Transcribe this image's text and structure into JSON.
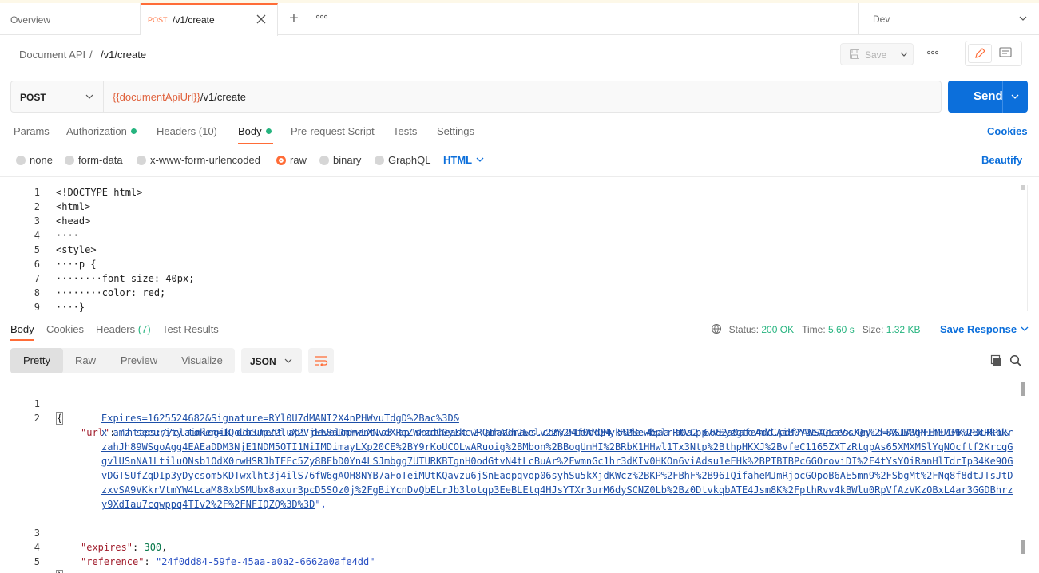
{
  "tabs": {
    "overview": "Overview",
    "active_method": "POST",
    "active_path": "/v1/create",
    "environment": "Dev"
  },
  "breadcrumb": {
    "parent": "Document API",
    "separator": "/",
    "current": "/v1/create",
    "save_label": "Save"
  },
  "request": {
    "method": "POST",
    "url_variable": "{{documentApiUrl}}",
    "url_path": "/v1/create",
    "send_label": "Send",
    "tabs": {
      "params": "Params",
      "authorization": "Authorization",
      "headers": "Headers",
      "headers_count": "(10)",
      "body": "Body",
      "prerequest": "Pre-request Script",
      "tests": "Tests",
      "settings": "Settings"
    },
    "cookies_label": "Cookies",
    "body_types": {
      "none": "none",
      "form_data": "form-data",
      "urlencoded": "x-www-form-urlencoded",
      "raw": "raw",
      "binary": "binary",
      "graphql": "GraphQL"
    },
    "selected_body_type": "raw",
    "language": "HTML",
    "beautify_label": "Beautify",
    "code_lines": [
      {
        "n": "1",
        "text": "<!DOCTYPE html>"
      },
      {
        "n": "2",
        "text": "<html>"
      },
      {
        "n": "3",
        "text": "<head>"
      },
      {
        "n": "4",
        "text": "····"
      },
      {
        "n": "5",
        "text": "<style>"
      },
      {
        "n": "6",
        "text": "····p {"
      },
      {
        "n": "7",
        "text": "········font-size: 40px;"
      },
      {
        "n": "8",
        "text": "········color: red;"
      },
      {
        "n": "9",
        "text": "····}"
      }
    ]
  },
  "response": {
    "tabs": {
      "body": "Body",
      "cookies": "Cookies",
      "headers": "Headers",
      "headers_count": "(7)",
      "test_results": "Test Results"
    },
    "status_label": "Status:",
    "status_value": "200 OK",
    "time_label": "Time:",
    "time_value": "5.60 s",
    "size_label": "Size:",
    "size_value": "1.32 KB",
    "save_response": "Save Response",
    "views": {
      "pretty": "Pretty",
      "raw": "Raw",
      "preview": "Preview",
      "visualize": "Visualize"
    },
    "format": "JSON",
    "body": {
      "open_brace": "{",
      "close_brace": "}",
      "url_key": "\"url\"",
      "url_lines": [
        "https://claimlogik-document-api-development.s3.ap-southeast-2.amazonaws.com/24f0dd84-59fe-45aa-a0a2-6662a0afe4dd.pdf?AWSAccessKeyId=ASIAVPFEMUIMKJPJURPU&",
        "Expires=1625524682&Signature=RYl0U7dMANI2X4nPHWvuTdgD%2Bac%3D&",
        "x-amz-security-token=IQoJb3JpZ2luX2VjEE8aDmFwLXNvdXRoZWFzdC0yIkcwRQIhAOh2Eolv22%2FLdAMQMyk%2BewbplrRtvCpp7vEyzgto7mYCAiB0Y2eAQEaVxJQn%2F8XJB0gMIhE736%2BcRkbkr",
        "zahJh89WSqoAgg4EAEaDDM3NjE1NDM5OTI1NiIMDimayLXp20CE%2BY9rKoUCOLwARuoig%2BMbon%2BBoqUmHI%2BRbK1HHwl1Tx3Ntp%2BthpHKXJ%2BvfeC1165ZXTzRtqpAs65XMXMSlYqNOcftf2KrcqG",
        "gvlUSnNA1LtiluONsb1OdX0rwHSRJhTEFc5Zy8BFbD0Yn4LSJmbgg7UTURKBTgnH0odGtvN4tLcBuAr%2FwmnGc1hr3dKIv0HKOn6viAdsu1eEHk%2BPTBTBPc6GOroviDI%2F4tYsYOiRanHlTdrIp34Ke9OG",
        "vDGTSUfZqDIp3yDycsom5KDTwxlht3j4ilS76fW6gAOH8NYB7aFoTeiMUtKQavzu6jSnEaopqvop06syhSu5kXjdKWcz%2BKP%2FBhF%2B96IQifaheMJmRjocGOpoB6AE5mn9%2FSbgMt%2FNq8f8dtJTsJtD",
        "zxvSA9VKkrVtmYW4LcaM88xbSMUbx8axur3pcD5SOz0j%2FgBiYcnDvQbELrJb3lotqp3EeBLEtq4HJsYTXr3urM6dySCNZ0Lb%2Bz0DtvkqbATE4Jsm8K%2FpthRvv4kBWlu0RpVfAzVKzOBxL4ar3GGDBhrz",
        "y9XdIau7cqwppq4TIv2%2F%2FNFIQZQ%3D%3D"
      ],
      "expires_key": "\"expires\"",
      "expires_value": "300",
      "reference_key": "\"reference\"",
      "reference_value": "\"24f0dd84-59fe-45aa-a0a2-6662a0afe4dd\""
    },
    "line_numbers": [
      "1",
      "2",
      "3",
      "4",
      "5"
    ]
  },
  "colors": {
    "accent": "#ff6c37",
    "primary": "#0c6fdb",
    "success": "#26b47f"
  }
}
